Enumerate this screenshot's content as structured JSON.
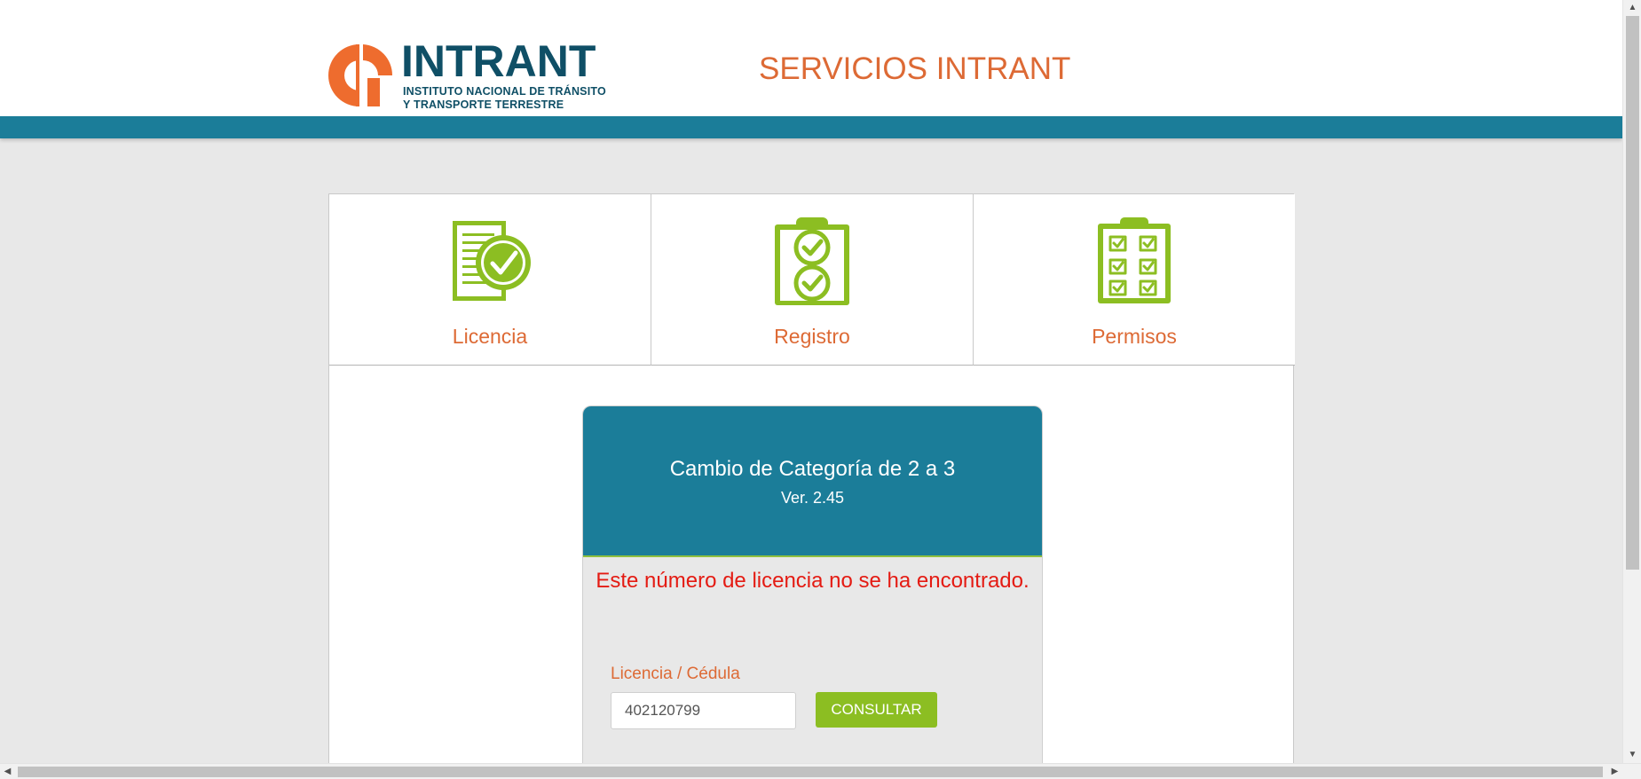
{
  "header": {
    "logo": {
      "wordmark": "INTRANT",
      "subtitle_line1": "INSTITUTO NACIONAL DE TRÁNSITO",
      "subtitle_line2": "Y TRANSPORTE TERRESTRE"
    },
    "site_title": "SERVICIOS INTRANT"
  },
  "tiles": [
    {
      "label": "Licencia",
      "icon": "document-check-icon"
    },
    {
      "label": "Registro",
      "icon": "clipboard-checks-icon"
    },
    {
      "label": "Permisos",
      "icon": "clipboard-checklist-icon"
    }
  ],
  "form": {
    "title": "Cambio de Categoría de 2 a 3",
    "version": "Ver. 2.45",
    "error_message": "Este número de licencia no se ha encontrado.",
    "field_label": "Licencia / Cédula",
    "field_value": "402120799",
    "submit_label": "CONSULTAR"
  },
  "colors": {
    "brand_teal": "#1b7d99",
    "brand_navy": "#0f4f66",
    "accent_orange": "#dd6a35",
    "icon_green": "#8cbe22",
    "error_red": "#e41b13"
  }
}
